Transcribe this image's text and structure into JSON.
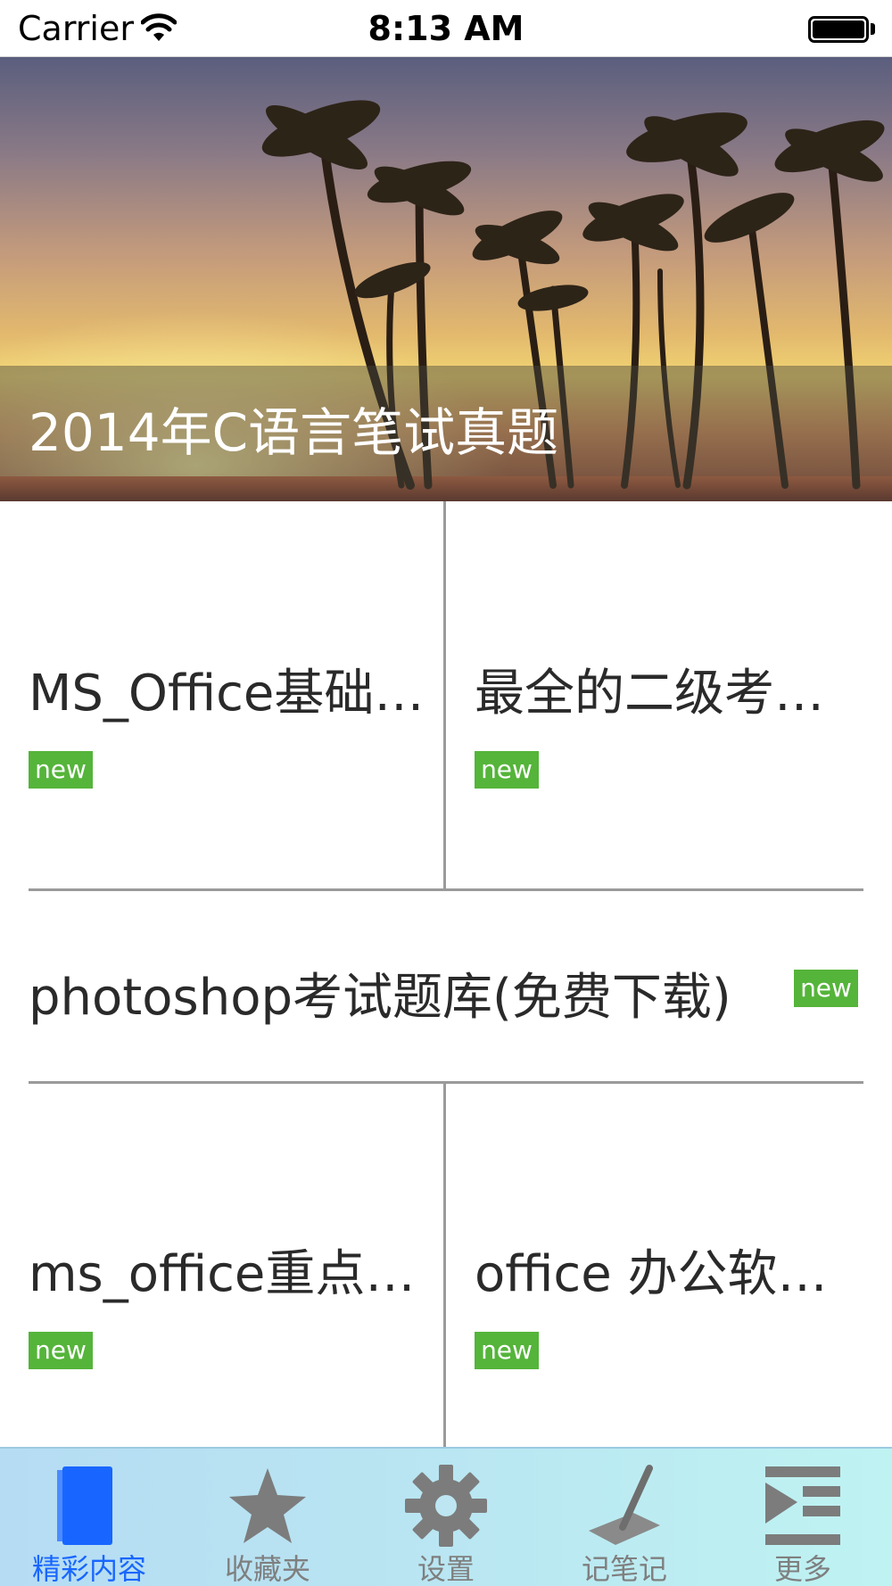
{
  "status_bar": {
    "carrier": "Carrier",
    "time": "8:13 AM"
  },
  "banner": {
    "title": "2014年C语言笔试真题",
    "image": "palm-trees-sunset-image"
  },
  "grid": {
    "row1_left": {
      "title": "MS_Office基础…",
      "badge": "new"
    },
    "row1_right": {
      "title": "最全的二级考…",
      "badge": "new"
    },
    "row2_full": {
      "title": "photoshop考试题库(免费下载)",
      "badge": "new"
    },
    "row3_left": {
      "title": "ms_office重点…",
      "badge": "new"
    },
    "row3_right": {
      "title": "office 办公软…",
      "badge": "new"
    }
  },
  "tab_bar": {
    "tabs": [
      {
        "label": "精彩内容",
        "icon": "book-icon",
        "active": true
      },
      {
        "label": "收藏夹",
        "icon": "star-icon",
        "active": false
      },
      {
        "label": "设置",
        "icon": "gear-icon",
        "active": false
      },
      {
        "label": "记笔记",
        "icon": "pen-icon",
        "active": false
      },
      {
        "label": "更多",
        "icon": "more-menu-icon",
        "active": false
      }
    ]
  },
  "colors": {
    "badge_green": "#55b43a",
    "tab_active": "#1866ff",
    "tab_inactive": "#7f7f7f",
    "divider": "#9a9a9a"
  }
}
